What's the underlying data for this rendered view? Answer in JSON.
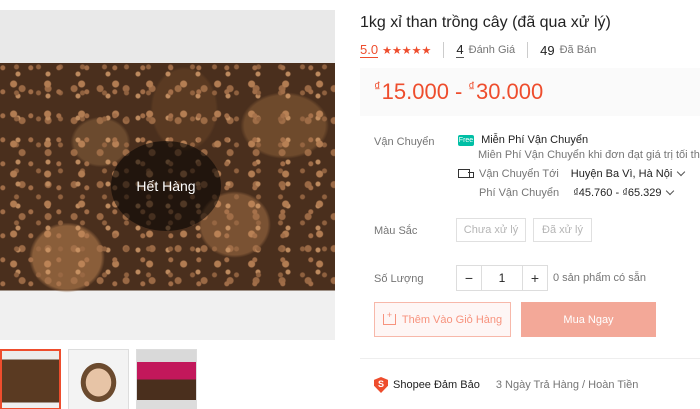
{
  "product": {
    "title": "1kg xỉ than trồng cây (đã qua xử lý)",
    "sold_out_label": "Hết Hàng"
  },
  "rating": {
    "score": "5.0",
    "stars": "★★★★★",
    "stars_value": 5,
    "review_count": "4",
    "review_label": "Đánh Giá",
    "sold_count": "49",
    "sold_label": "Đã Bán"
  },
  "price": {
    "currency": "₫",
    "min": "15.000",
    "separator": "-",
    "max": "30.000"
  },
  "shipping": {
    "label": "Vận Chuyển",
    "free_badge": "Free",
    "free_title": "Miễn Phí Vận Chuyển",
    "free_desc": "Miễn Phí Vận Chuyển khi đơn đạt giá trị tối thiểu",
    "ship_to_label": "Vận Chuyển Tới",
    "ship_to_value": "Huyện Ba Vì, Hà Nội",
    "fee_label": "Phí Vận Chuyển",
    "fee_value": "₫45.760 - ₫65.329"
  },
  "variation": {
    "label": "Màu Sắc",
    "options": [
      "Chưa xử lý",
      "Đã xử lý"
    ]
  },
  "quantity": {
    "label": "Số Lượng",
    "minus": "−",
    "value": "1",
    "plus": "+",
    "stock_text": "0 sản phẩm có sẵn"
  },
  "actions": {
    "add_to_cart": "Thêm Vào Giỏ Hàng",
    "buy_now": "Mua Ngay"
  },
  "guarantee": {
    "icon_letter": "S",
    "title": "Shopee Đảm Bảo",
    "desc": "3 Ngày Trả Hàng / Hoàn Tiền"
  },
  "colors": {
    "accent": "#ee4d2d",
    "free_badge": "#00bfa5",
    "buy_now_disabled": "#f3a898"
  },
  "icons": [
    "free-shipping-icon",
    "truck-icon",
    "chevron-down-icon",
    "cart-icon",
    "shield-icon",
    "star-icon"
  ]
}
